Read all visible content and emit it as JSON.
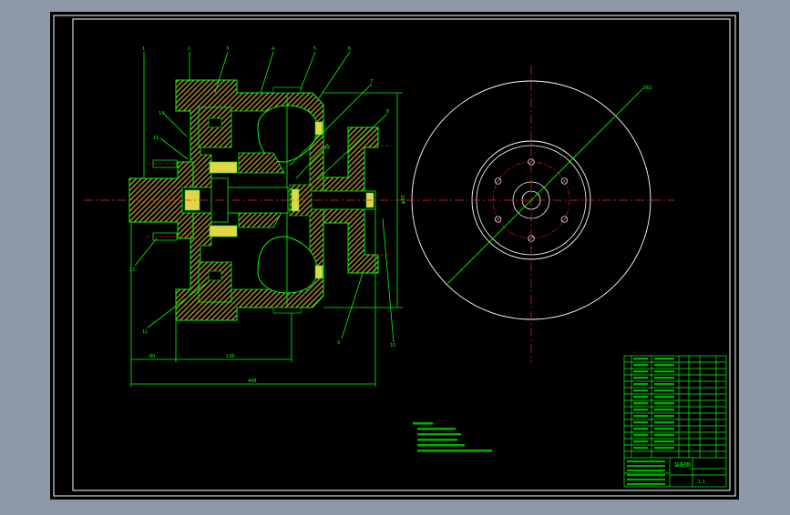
{
  "colors": {
    "viewport_bg": "#8d99a6",
    "sheet": "#000000",
    "frame": "#ffffff",
    "geometry": "#00ff00",
    "hatch": "#c8a23a",
    "center_line": "#ff2020",
    "text": "#00ff00"
  },
  "labels": {
    "part_1": "1",
    "part_2": "2",
    "part_3": "3",
    "part_4": "4",
    "part_5": "5",
    "part_6": "6",
    "part_7": "7",
    "part_8": "8",
    "part_9": "9",
    "part_10": "10",
    "part_11": "11",
    "part_12": "12",
    "part_14": "14",
    "part_15": "15",
    "part_16": "16",
    "dim_left": "80",
    "dim_mid": "136",
    "dim_total": "448",
    "dim_right": "φ80",
    "dim_diameter": "562",
    "title_drawing": "装配图",
    "title_scale": "1:1"
  },
  "icons": {
    "flywheel": "flywheel-side-view-icon",
    "coupling": "fluid-coupling-section-icon"
  }
}
